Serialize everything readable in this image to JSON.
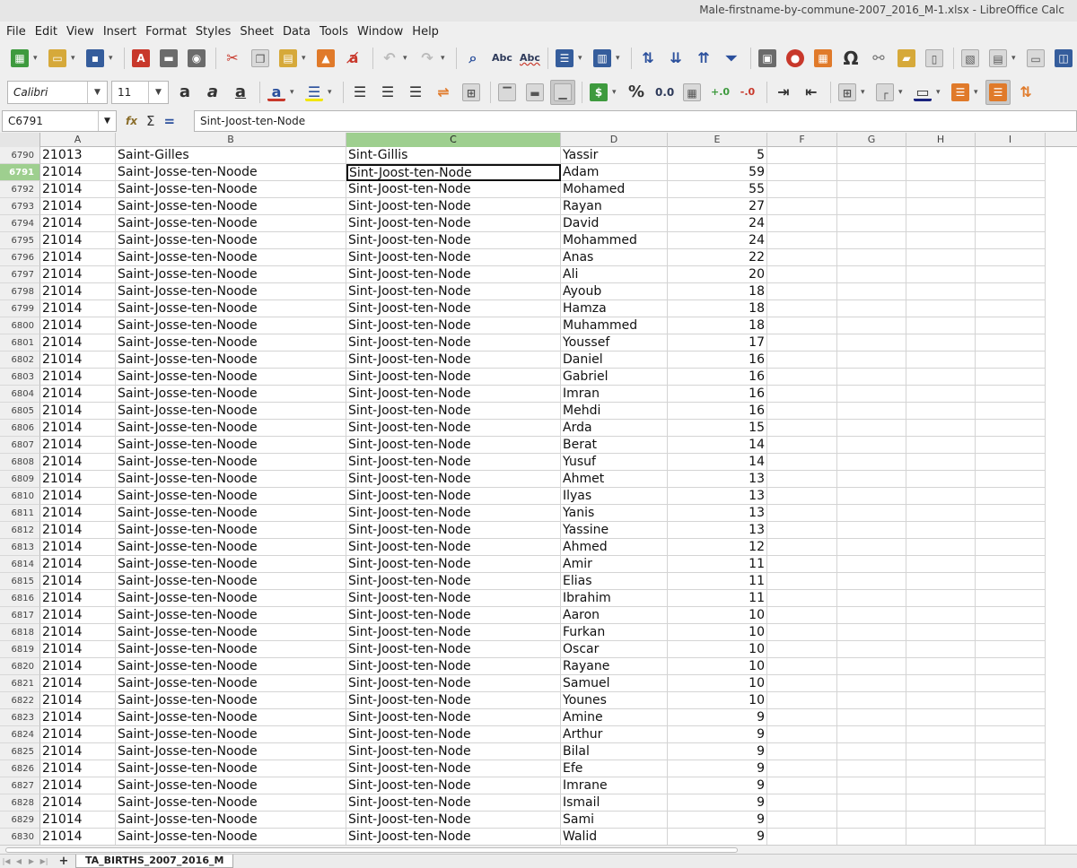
{
  "window": {
    "title": "Male-firstname-by-commune-2007_2016_M-1.xlsx - LibreOffice Calc"
  },
  "menu": [
    "File",
    "Edit",
    "View",
    "Insert",
    "Format",
    "Styles",
    "Sheet",
    "Data",
    "Tools",
    "Window",
    "Help"
  ],
  "format": {
    "font_name": "Calibri",
    "font_size": "11"
  },
  "formula_bar": {
    "cell_ref": "C6791",
    "content": "Sint-Joost-ten-Node"
  },
  "columns": [
    "A",
    "B",
    "C",
    "D",
    "E",
    "F",
    "G",
    "H",
    "I"
  ],
  "selected_column": "C",
  "selected_row": "6791",
  "rows": [
    {
      "n": "6790",
      "a": "21013",
      "b": "Saint-Gilles",
      "c": "Sint-Gillis",
      "d": "Yassir",
      "e": "5"
    },
    {
      "n": "6791",
      "a": "21014",
      "b": "Saint-Josse-ten-Noode",
      "c": "Sint-Joost-ten-Node",
      "d": "Adam",
      "e": "59"
    },
    {
      "n": "6792",
      "a": "21014",
      "b": "Saint-Josse-ten-Noode",
      "c": "Sint-Joost-ten-Node",
      "d": "Mohamed",
      "e": "55"
    },
    {
      "n": "6793",
      "a": "21014",
      "b": "Saint-Josse-ten-Noode",
      "c": "Sint-Joost-ten-Node",
      "d": "Rayan",
      "e": "27"
    },
    {
      "n": "6794",
      "a": "21014",
      "b": "Saint-Josse-ten-Noode",
      "c": "Sint-Joost-ten-Node",
      "d": "David",
      "e": "24"
    },
    {
      "n": "6795",
      "a": "21014",
      "b": "Saint-Josse-ten-Noode",
      "c": "Sint-Joost-ten-Node",
      "d": "Mohammed",
      "e": "24"
    },
    {
      "n": "6796",
      "a": "21014",
      "b": "Saint-Josse-ten-Noode",
      "c": "Sint-Joost-ten-Node",
      "d": "Anas",
      "e": "22"
    },
    {
      "n": "6797",
      "a": "21014",
      "b": "Saint-Josse-ten-Noode",
      "c": "Sint-Joost-ten-Node",
      "d": "Ali",
      "e": "20"
    },
    {
      "n": "6798",
      "a": "21014",
      "b": "Saint-Josse-ten-Noode",
      "c": "Sint-Joost-ten-Node",
      "d": "Ayoub",
      "e": "18"
    },
    {
      "n": "6799",
      "a": "21014",
      "b": "Saint-Josse-ten-Noode",
      "c": "Sint-Joost-ten-Node",
      "d": "Hamza",
      "e": "18"
    },
    {
      "n": "6800",
      "a": "21014",
      "b": "Saint-Josse-ten-Noode",
      "c": "Sint-Joost-ten-Node",
      "d": "Muhammed",
      "e": "18"
    },
    {
      "n": "6801",
      "a": "21014",
      "b": "Saint-Josse-ten-Noode",
      "c": "Sint-Joost-ten-Node",
      "d": "Youssef",
      "e": "17"
    },
    {
      "n": "6802",
      "a": "21014",
      "b": "Saint-Josse-ten-Noode",
      "c": "Sint-Joost-ten-Node",
      "d": "Daniel",
      "e": "16"
    },
    {
      "n": "6803",
      "a": "21014",
      "b": "Saint-Josse-ten-Noode",
      "c": "Sint-Joost-ten-Node",
      "d": "Gabriel",
      "e": "16"
    },
    {
      "n": "6804",
      "a": "21014",
      "b": "Saint-Josse-ten-Noode",
      "c": "Sint-Joost-ten-Node",
      "d": "Imran",
      "e": "16"
    },
    {
      "n": "6805",
      "a": "21014",
      "b": "Saint-Josse-ten-Noode",
      "c": "Sint-Joost-ten-Node",
      "d": "Mehdi",
      "e": "16"
    },
    {
      "n": "6806",
      "a": "21014",
      "b": "Saint-Josse-ten-Noode",
      "c": "Sint-Joost-ten-Node",
      "d": "Arda",
      "e": "15"
    },
    {
      "n": "6807",
      "a": "21014",
      "b": "Saint-Josse-ten-Noode",
      "c": "Sint-Joost-ten-Node",
      "d": "Berat",
      "e": "14"
    },
    {
      "n": "6808",
      "a": "21014",
      "b": "Saint-Josse-ten-Noode",
      "c": "Sint-Joost-ten-Node",
      "d": "Yusuf",
      "e": "14"
    },
    {
      "n": "6809",
      "a": "21014",
      "b": "Saint-Josse-ten-Noode",
      "c": "Sint-Joost-ten-Node",
      "d": "Ahmet",
      "e": "13"
    },
    {
      "n": "6810",
      "a": "21014",
      "b": "Saint-Josse-ten-Noode",
      "c": "Sint-Joost-ten-Node",
      "d": "Ilyas",
      "e": "13"
    },
    {
      "n": "6811",
      "a": "21014",
      "b": "Saint-Josse-ten-Noode",
      "c": "Sint-Joost-ten-Node",
      "d": "Yanis",
      "e": "13"
    },
    {
      "n": "6812",
      "a": "21014",
      "b": "Saint-Josse-ten-Noode",
      "c": "Sint-Joost-ten-Node",
      "d": "Yassine",
      "e": "13"
    },
    {
      "n": "6813",
      "a": "21014",
      "b": "Saint-Josse-ten-Noode",
      "c": "Sint-Joost-ten-Node",
      "d": "Ahmed",
      "e": "12"
    },
    {
      "n": "6814",
      "a": "21014",
      "b": "Saint-Josse-ten-Noode",
      "c": "Sint-Joost-ten-Node",
      "d": "Amir",
      "e": "11"
    },
    {
      "n": "6815",
      "a": "21014",
      "b": "Saint-Josse-ten-Noode",
      "c": "Sint-Joost-ten-Node",
      "d": "Elias",
      "e": "11"
    },
    {
      "n": "6816",
      "a": "21014",
      "b": "Saint-Josse-ten-Noode",
      "c": "Sint-Joost-ten-Node",
      "d": "Ibrahim",
      "e": "11"
    },
    {
      "n": "6817",
      "a": "21014",
      "b": "Saint-Josse-ten-Noode",
      "c": "Sint-Joost-ten-Node",
      "d": "Aaron",
      "e": "10"
    },
    {
      "n": "6818",
      "a": "21014",
      "b": "Saint-Josse-ten-Noode",
      "c": "Sint-Joost-ten-Node",
      "d": "Furkan",
      "e": "10"
    },
    {
      "n": "6819",
      "a": "21014",
      "b": "Saint-Josse-ten-Noode",
      "c": "Sint-Joost-ten-Node",
      "d": "Oscar",
      "e": "10"
    },
    {
      "n": "6820",
      "a": "21014",
      "b": "Saint-Josse-ten-Noode",
      "c": "Sint-Joost-ten-Node",
      "d": "Rayane",
      "e": "10"
    },
    {
      "n": "6821",
      "a": "21014",
      "b": "Saint-Josse-ten-Noode",
      "c": "Sint-Joost-ten-Node",
      "d": "Samuel",
      "e": "10"
    },
    {
      "n": "6822",
      "a": "21014",
      "b": "Saint-Josse-ten-Noode",
      "c": "Sint-Joost-ten-Node",
      "d": "Younes",
      "e": "10"
    },
    {
      "n": "6823",
      "a": "21014",
      "b": "Saint-Josse-ten-Noode",
      "c": "Sint-Joost-ten-Node",
      "d": "Amine",
      "e": "9"
    },
    {
      "n": "6824",
      "a": "21014",
      "b": "Saint-Josse-ten-Noode",
      "c": "Sint-Joost-ten-Node",
      "d": "Arthur",
      "e": "9"
    },
    {
      "n": "6825",
      "a": "21014",
      "b": "Saint-Josse-ten-Noode",
      "c": "Sint-Joost-ten-Node",
      "d": "Bilal",
      "e": "9"
    },
    {
      "n": "6826",
      "a": "21014",
      "b": "Saint-Josse-ten-Noode",
      "c": "Sint-Joost-ten-Node",
      "d": "Efe",
      "e": "9"
    },
    {
      "n": "6827",
      "a": "21014",
      "b": "Saint-Josse-ten-Noode",
      "c": "Sint-Joost-ten-Node",
      "d": "Imrane",
      "e": "9"
    },
    {
      "n": "6828",
      "a": "21014",
      "b": "Saint-Josse-ten-Noode",
      "c": "Sint-Joost-ten-Node",
      "d": "Ismail",
      "e": "9"
    },
    {
      "n": "6829",
      "a": "21014",
      "b": "Saint-Josse-ten-Noode",
      "c": "Sint-Joost-ten-Node",
      "d": "Sami",
      "e": "9"
    },
    {
      "n": "6830",
      "a": "21014",
      "b": "Saint-Josse-ten-Noode",
      "c": "Sint-Joost-ten-Node",
      "d": "Walid",
      "e": "9"
    }
  ],
  "sheet_tabs": [
    "TA_BIRTHS_2007_2016_M"
  ]
}
